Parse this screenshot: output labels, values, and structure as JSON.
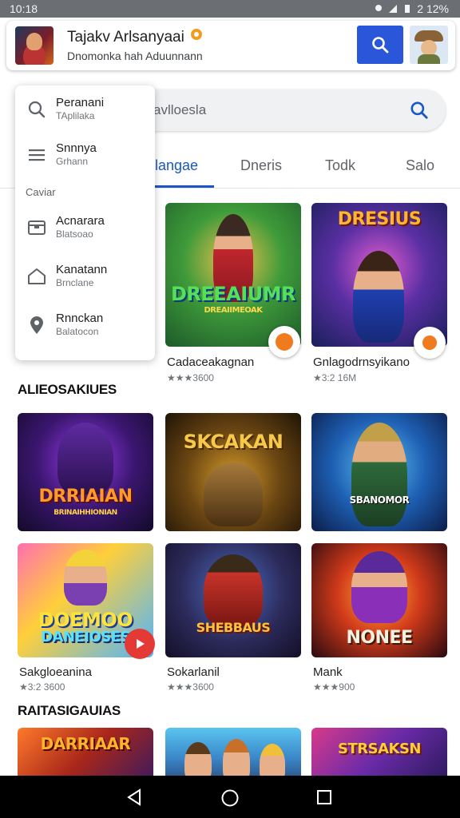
{
  "status_bar": {
    "time": "10:18",
    "battery": "2 12%"
  },
  "header": {
    "title": "Tajakv Arlsanyaai",
    "subtitle": "Dnomonka hah Aduunnann"
  },
  "search": {
    "placeholder": "avlloesla"
  },
  "tabs": [
    {
      "label": "Ilangae",
      "active": true
    },
    {
      "label": "Dneris"
    },
    {
      "label": "Todk"
    },
    {
      "label": "Salo"
    }
  ],
  "menu": {
    "items": [
      {
        "label": "Peranani",
        "sub": "TAplilaka",
        "icon": "search-icon"
      },
      {
        "label": "Snnnya",
        "sub": "Grhann",
        "icon": "list-icon"
      },
      {
        "label": "Acnarara",
        "sub": "Blatsoao",
        "icon": "inbox-icon"
      },
      {
        "label": "Kanatann",
        "sub": "Brnclane",
        "icon": "home-icon"
      },
      {
        "label": "Rnnckan",
        "sub": "Balatocon",
        "icon": "location-icon"
      }
    ],
    "section_label": "Caviar"
  },
  "featured": [
    {
      "name": "Cadaceakagnan",
      "rating": "★★★3600",
      "art_title": "DREEAIUMR",
      "art_sub": "DREAIIMEOAK",
      "icon": "orange-badge-icon"
    },
    {
      "name": "Gnlagodrnsyikano",
      "rating": "★3:2 16M",
      "art_title": "DRESIUS",
      "art_sub": "",
      "icon": "orange-badge-icon"
    }
  ],
  "sections": [
    {
      "title": "ALIEOSAKIUES",
      "games": [
        {
          "name": "",
          "rating": "",
          "art_title": "DRRIAIAN",
          "art_sub": "BRINAIHHIONIAN"
        },
        {
          "name": "",
          "rating": "",
          "art_title": "SKCAKAN",
          "art_sub": ""
        },
        {
          "name": "",
          "rating": "",
          "art_title": "",
          "art_sub": "SBANOMOR"
        }
      ]
    },
    {
      "title": "",
      "games": [
        {
          "name": "Sakgloeanina",
          "rating": "★3:2 3600",
          "art_title": "DOEMOO",
          "art_sub": "DANEIOSES",
          "icon": "play-icon"
        },
        {
          "name": "Sokarlanil",
          "rating": "★★★3600",
          "art_title": "",
          "art_sub": "SHEBBAUS"
        },
        {
          "name": "Mank",
          "rating": "★★★900",
          "art_title": "NONEE",
          "art_sub": ""
        }
      ]
    },
    {
      "title": "RAITASIGAUIAS",
      "games": [
        {
          "name": "",
          "rating": "",
          "art_title": "DARRIAAR",
          "art_sub": ""
        },
        {
          "name": "",
          "rating": "",
          "art_title": "",
          "art_sub": ""
        },
        {
          "name": "",
          "rating": "",
          "art_title": "STRSAKSN",
          "art_sub": ""
        }
      ]
    }
  ],
  "colors": {
    "accent": "#2a56d9",
    "tab_active": "#1a56c4",
    "badge": "#f07a1e",
    "play": "#e53935"
  }
}
